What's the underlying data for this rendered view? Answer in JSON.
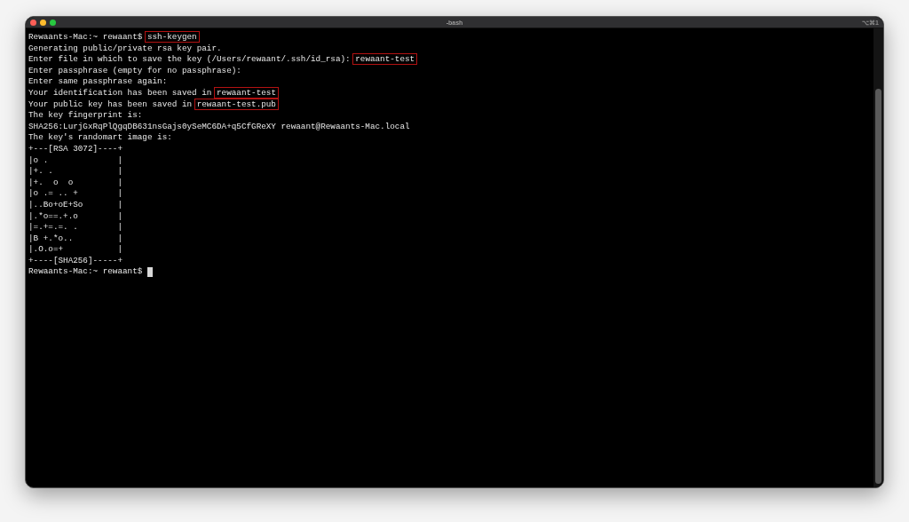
{
  "window": {
    "title": "-bash",
    "shortcut": "⌥⌘1"
  },
  "lines": [
    {
      "segments": [
        {
          "text": "Rewaants-Mac:~ rewaant$ ",
          "boxed": false
        },
        {
          "text": "ssh-keygen",
          "boxed": true
        }
      ]
    },
    {
      "segments": [
        {
          "text": "Generating public/private rsa key pair.",
          "boxed": false
        }
      ]
    },
    {
      "segments": [
        {
          "text": "Enter file in which to save the key (/Users/rewaant/.ssh/id_rsa): ",
          "boxed": false
        },
        {
          "text": "rewaant-test",
          "boxed": true
        }
      ]
    },
    {
      "segments": [
        {
          "text": "Enter passphrase (empty for no passphrase):",
          "boxed": false
        }
      ]
    },
    {
      "segments": [
        {
          "text": "Enter same passphrase again:",
          "boxed": false
        }
      ]
    },
    {
      "segments": [
        {
          "text": "Your identification has been saved in ",
          "boxed": false
        },
        {
          "text": "rewaant-test",
          "boxed": true
        }
      ]
    },
    {
      "segments": [
        {
          "text": "Your public key has been saved in ",
          "boxed": false
        },
        {
          "text": "rewaant-test.pub",
          "boxed": true
        }
      ]
    },
    {
      "segments": [
        {
          "text": "The key fingerprint is:",
          "boxed": false
        }
      ]
    },
    {
      "segments": [
        {
          "text": "SHA256:LurjGxRqPlQgqDB631nsGajs0ySeMC6DA+q5CfGReXY rewaant@Rewaants-Mac.local",
          "boxed": false
        }
      ]
    },
    {
      "segments": [
        {
          "text": "The key's randomart image is:",
          "boxed": false
        }
      ]
    },
    {
      "segments": [
        {
          "text": "+---[RSA 3072]----+",
          "boxed": false
        }
      ]
    },
    {
      "segments": [
        {
          "text": "|o .              |",
          "boxed": false
        }
      ]
    },
    {
      "segments": [
        {
          "text": "|+. .             |",
          "boxed": false
        }
      ]
    },
    {
      "segments": [
        {
          "text": "|+.  o  o         |",
          "boxed": false
        }
      ]
    },
    {
      "segments": [
        {
          "text": "|o .= .. +        |",
          "boxed": false
        }
      ]
    },
    {
      "segments": [
        {
          "text": "|..Bo+oE+So       |",
          "boxed": false
        }
      ]
    },
    {
      "segments": [
        {
          "text": "|.*o==.+.o        |",
          "boxed": false
        }
      ]
    },
    {
      "segments": [
        {
          "text": "|=.+=.=. .        |",
          "boxed": false
        }
      ]
    },
    {
      "segments": [
        {
          "text": "|B +.*o..         |",
          "boxed": false
        }
      ]
    },
    {
      "segments": [
        {
          "text": "|.O.o=+           |",
          "boxed": false
        }
      ]
    },
    {
      "segments": [
        {
          "text": "+----[SHA256]-----+",
          "boxed": false
        }
      ]
    }
  ],
  "prompt": {
    "text": "Rewaants-Mac:~ rewaant$ ",
    "cursor": true
  }
}
